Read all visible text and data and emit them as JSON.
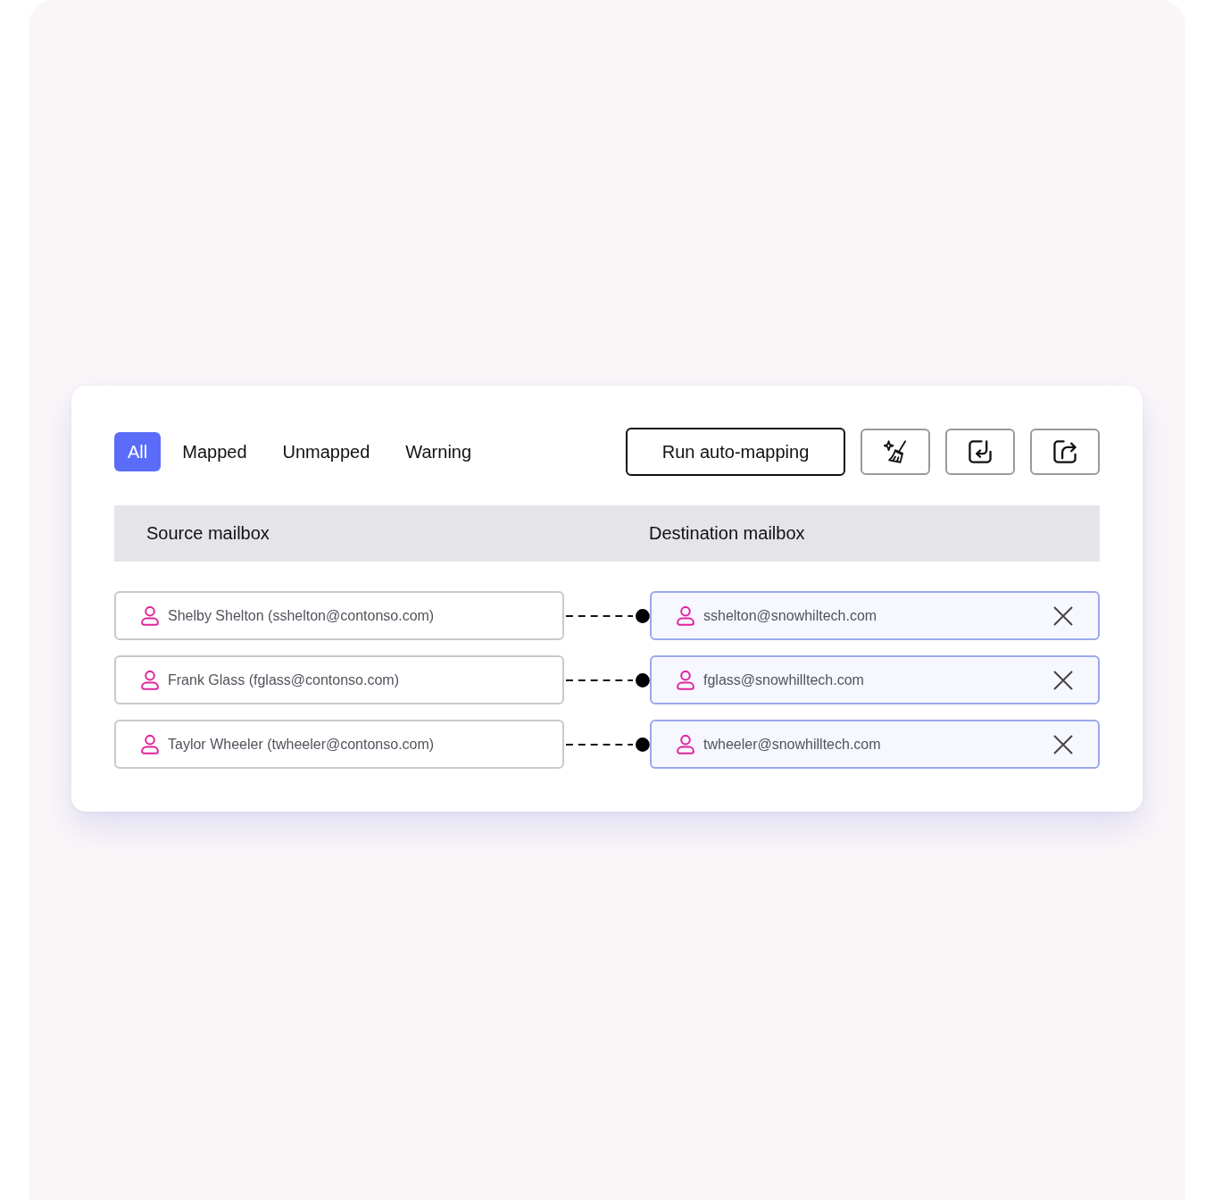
{
  "tabs": [
    {
      "label": "All",
      "selected": true
    },
    {
      "label": "Mapped",
      "selected": false
    },
    {
      "label": "Unmapped",
      "selected": false
    },
    {
      "label": "Warning",
      "selected": false
    }
  ],
  "toolbar": {
    "run_button": "Run auto-mapping",
    "icon_buttons": [
      {
        "kind": "clean"
      },
      {
        "kind": "import"
      },
      {
        "kind": "export"
      }
    ]
  },
  "table": {
    "columns": [
      "Source mailbox",
      "Destination mailbox"
    ],
    "rows": [
      {
        "source": "Shelby Shelton (sshelton@contonso.com)",
        "destination": "sshelton@snowhiltech.com"
      },
      {
        "source": "Frank Glass (fglass@contonso.com)",
        "destination": "fglass@snowhilltech.com"
      },
      {
        "source": "Taylor Wheeler (twheeler@contonso.com)",
        "destination": "twheeler@snowhilltech.com"
      }
    ]
  }
}
